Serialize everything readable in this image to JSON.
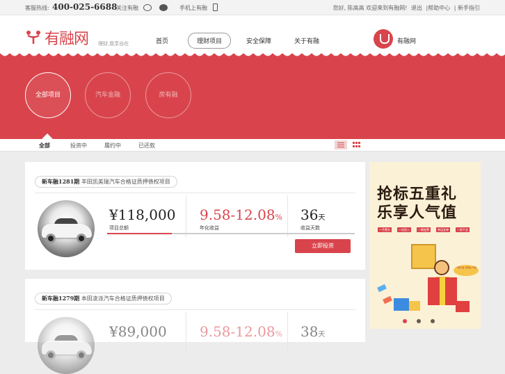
{
  "topbar": {
    "hotline_label": "客服热线:",
    "hotline_number": "400-025-6688",
    "follow_label": "关注有融",
    "mobile_label": "手机上有融",
    "welcome": "您好, 陈高高 欢迎来到有融网!",
    "logout": "退出",
    "help": "|帮助中心",
    "guide": "| 新手指引"
  },
  "header": {
    "logo_text": "有融网",
    "slogan": "理财,我享自在",
    "nav": [
      "首页",
      "理财项目",
      "安全保障",
      "关于有融"
    ],
    "brand_name": "有融网"
  },
  "categories": [
    "全部项目",
    "汽车金融",
    "房有融"
  ],
  "tabs": [
    "全部",
    "投资中",
    "履约中",
    "已还款"
  ],
  "projects": [
    {
      "code": "新车融1281期",
      "title": "丰田凯美瑞汽车合格证质押债权项目",
      "amount": "¥118,000",
      "amount_label": "项目总额",
      "rate": "9.58-12.08",
      "rate_unit": "%",
      "rate_label": "年化收益",
      "days": "36",
      "days_unit": "天",
      "days_label": "收益天数",
      "progress": 0.26,
      "invest_label": "立即投资"
    },
    {
      "code": "新车融1279期",
      "title": "本田凌派汽车合格证质押债权项目",
      "amount": "¥89,000",
      "rate": "9.58-12.08",
      "rate_unit": "%",
      "days": "38",
      "days_unit": "天"
    }
  ],
  "ad": {
    "line1": "抢标五重礼",
    "line2": "乐享人气值",
    "tags": [
      "一手费头",
      "一倍投入",
      "一期变费",
      "幸运女神",
      "一家千金"
    ],
    "coin_text": "一倍千金 4年倍入气值",
    "active_slide": 0
  },
  "colors": {
    "accent": "#d9444c"
  }
}
